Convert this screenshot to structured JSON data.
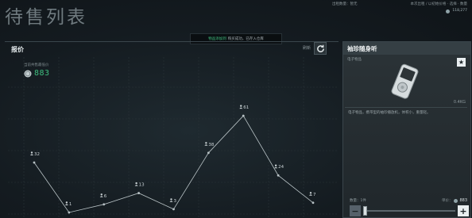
{
  "page": {
    "title": "待售列表"
  },
  "top_info": {
    "left_text": "出租数量：暂无",
    "right_text": "本次出租 / 以初始价格 · 选择 · 数量",
    "currency_value": "118,277"
  },
  "toast": {
    "highlight": "物品添加到",
    "text": "购买成功，已存入仓库"
  },
  "price_panel": {
    "title": "报价",
    "refresh_label": "刷新",
    "current_price_label": "当前共售最低价",
    "current_price": "883"
  },
  "chart_data": {
    "type": "line",
    "title": "",
    "xlabel": "",
    "ylabel": "",
    "ylim": [
      0,
      63
    ],
    "grid": true,
    "points": [
      {
        "x": 1,
        "y": 32,
        "label": "32"
      },
      {
        "x": 2,
        "y": 1,
        "label": "1"
      },
      {
        "x": 3,
        "y": 6,
        "label": "6"
      },
      {
        "x": 4,
        "y": 13,
        "label": "13"
      },
      {
        "x": 5,
        "y": 3,
        "label": "3"
      },
      {
        "x": 6,
        "y": 38,
        "label": "38"
      },
      {
        "x": 7,
        "y": 61,
        "label": "61"
      },
      {
        "x": 8,
        "y": 24,
        "label": "24"
      },
      {
        "x": 9,
        "y": 7,
        "label": "7"
      }
    ],
    "colors": {
      "line": "#b9c3c6",
      "label": "#c9d1d4"
    }
  },
  "item_card": {
    "name": "袖珍随身听",
    "category": "电子物品",
    "weight": "0.4KG",
    "description": "电子物品，携带型的袖珍播放机，体积小，重量轻。",
    "quantity_label": "数量：1件",
    "unit_price_label": "单价：",
    "unit_price": "883",
    "star_icon": "star-icon"
  }
}
